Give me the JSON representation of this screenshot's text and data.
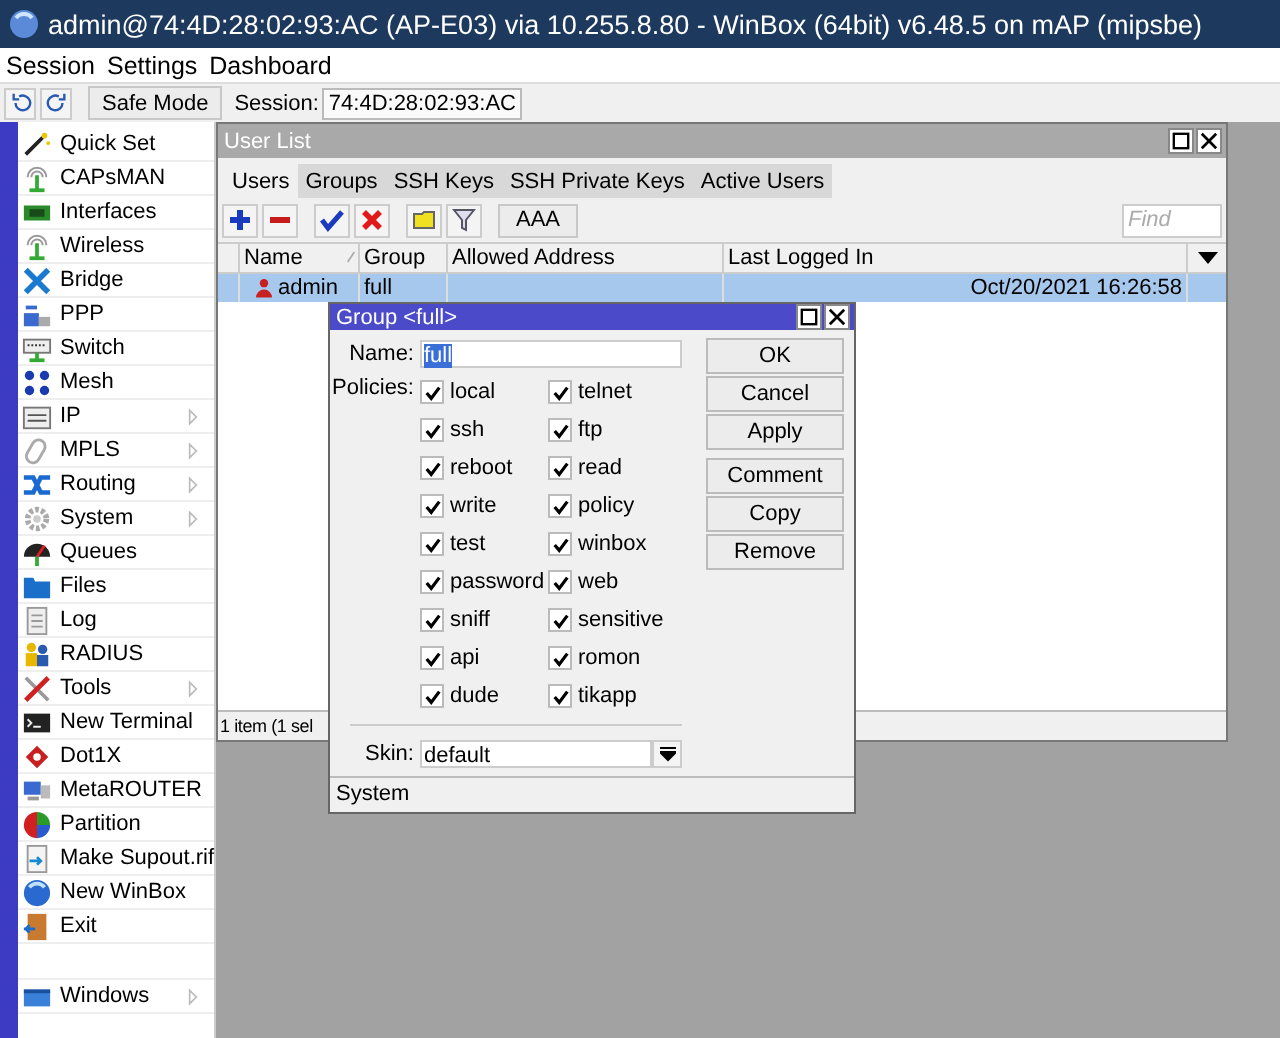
{
  "window": {
    "title": "admin@74:4D:28:02:93:AC (AP-E03) via 10.255.8.80 - WinBox (64bit) v6.48.5 on mAP (mipsbe)"
  },
  "menu": [
    "Session",
    "Settings",
    "Dashboard"
  ],
  "toolbar": {
    "safe_mode": "Safe Mode",
    "session_label": "Session:",
    "session_value": "74:4D:28:02:93:AC"
  },
  "sidebar": {
    "items": [
      {
        "label": "Quick Set",
        "has_submenu": false
      },
      {
        "label": "CAPsMAN",
        "has_submenu": false
      },
      {
        "label": "Interfaces",
        "has_submenu": false
      },
      {
        "label": "Wireless",
        "has_submenu": false
      },
      {
        "label": "Bridge",
        "has_submenu": false
      },
      {
        "label": "PPP",
        "has_submenu": false
      },
      {
        "label": "Switch",
        "has_submenu": false
      },
      {
        "label": "Mesh",
        "has_submenu": false
      },
      {
        "label": "IP",
        "has_submenu": true
      },
      {
        "label": "MPLS",
        "has_submenu": true
      },
      {
        "label": "Routing",
        "has_submenu": true
      },
      {
        "label": "System",
        "has_submenu": true
      },
      {
        "label": "Queues",
        "has_submenu": false
      },
      {
        "label": "Files",
        "has_submenu": false
      },
      {
        "label": "Log",
        "has_submenu": false
      },
      {
        "label": "RADIUS",
        "has_submenu": false
      },
      {
        "label": "Tools",
        "has_submenu": true
      },
      {
        "label": "New Terminal",
        "has_submenu": false
      },
      {
        "label": "Dot1X",
        "has_submenu": false
      },
      {
        "label": "MetaROUTER",
        "has_submenu": false
      },
      {
        "label": "Partition",
        "has_submenu": false
      },
      {
        "label": "Make Supout.rif",
        "has_submenu": false
      },
      {
        "label": "New WinBox",
        "has_submenu": false
      },
      {
        "label": "Exit",
        "has_submenu": false
      }
    ],
    "bottom_items": [
      {
        "label": "Windows",
        "has_submenu": true
      }
    ]
  },
  "user_list": {
    "title": "User List",
    "tabs": [
      {
        "label": "Users",
        "selected": true
      },
      {
        "label": "Groups",
        "selected": false
      },
      {
        "label": "SSH Keys",
        "selected": false
      },
      {
        "label": "SSH Private Keys",
        "selected": false
      },
      {
        "label": "Active Users",
        "selected": false
      }
    ],
    "aaa_button": "AAA",
    "find_placeholder": "Find",
    "columns": [
      "Name",
      "Group",
      "Allowed Address",
      "Last Logged In"
    ],
    "rows": [
      {
        "name": "admin",
        "group": "full",
        "last_logged_in": "Oct/20/2021 16:26:58",
        "selected": true
      }
    ],
    "status": "1 item (1 sel"
  },
  "dialog": {
    "title": "Group <full>",
    "name_label": "Name:",
    "name_value": "full",
    "policies_label": "Policies:",
    "policies": [
      {
        "label": "local",
        "checked": true
      },
      {
        "label": "telnet",
        "checked": true
      },
      {
        "label": "ssh",
        "checked": true
      },
      {
        "label": "ftp",
        "checked": true
      },
      {
        "label": "reboot",
        "checked": true
      },
      {
        "label": "read",
        "checked": true
      },
      {
        "label": "write",
        "checked": true
      },
      {
        "label": "policy",
        "checked": true
      },
      {
        "label": "test",
        "checked": true
      },
      {
        "label": "winbox",
        "checked": true
      },
      {
        "label": "password",
        "checked": true
      },
      {
        "label": "web",
        "checked": true
      },
      {
        "label": "sniff",
        "checked": true
      },
      {
        "label": "sensitive",
        "checked": true
      },
      {
        "label": "api",
        "checked": true
      },
      {
        "label": "romon",
        "checked": true
      },
      {
        "label": "dude",
        "checked": true
      },
      {
        "label": "tikapp",
        "checked": true
      }
    ],
    "skin_label": "Skin:",
    "skin_value": "default",
    "buttons": [
      "OK",
      "Cancel",
      "Apply",
      "Comment",
      "Copy",
      "Remove"
    ],
    "status": "System"
  }
}
